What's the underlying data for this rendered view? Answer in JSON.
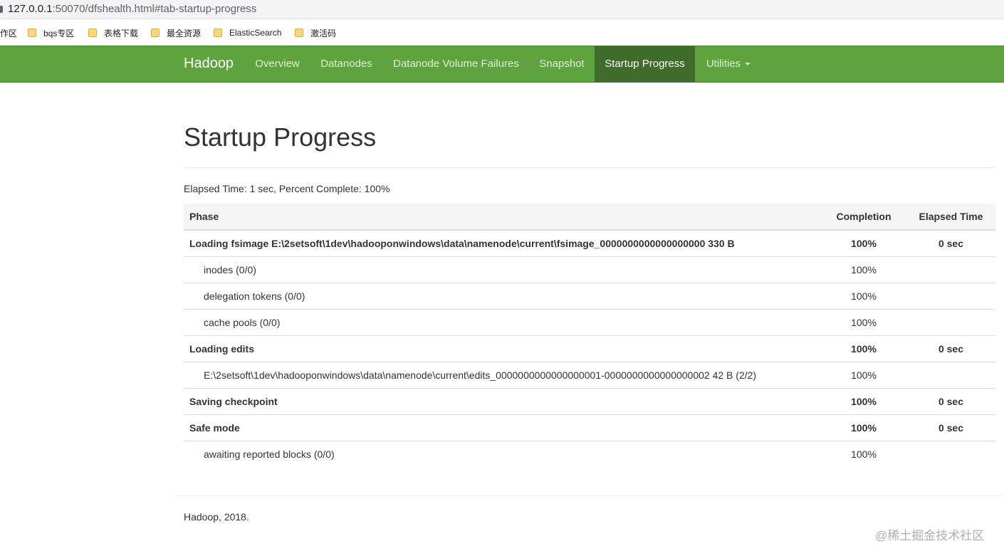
{
  "browser": {
    "url_host": "127.0.0.1",
    "url_rest": ":50070/dfshealth.html#tab-startup-progress"
  },
  "bookmarks": [
    {
      "label": "作区"
    },
    {
      "label": "bqs专区"
    },
    {
      "label": "表格下载"
    },
    {
      "label": "最全资源"
    },
    {
      "label": "ElasticSearch"
    },
    {
      "label": "激活码"
    }
  ],
  "navbar": {
    "brand": "Hadoop",
    "links": [
      {
        "label": "Overview"
      },
      {
        "label": "Datanodes"
      },
      {
        "label": "Datanode Volume Failures"
      },
      {
        "label": "Snapshot"
      },
      {
        "label": "Startup Progress"
      },
      {
        "label": "Utilities"
      }
    ]
  },
  "page": {
    "title": "Startup Progress",
    "summary": "Elapsed Time: 1 sec, Percent Complete: 100%"
  },
  "table": {
    "headers": {
      "phase": "Phase",
      "completion": "Completion",
      "elapsed": "Elapsed Time"
    },
    "rows": [
      {
        "phase": "Loading fsimage E:\\2setsoft\\1dev\\hadooponwindows\\data\\namenode\\current\\fsimage_0000000000000000000 330 B",
        "completion": "100%",
        "elapsed": "0 sec"
      },
      {
        "phase": "inodes (0/0)",
        "completion": "100%",
        "elapsed": ""
      },
      {
        "phase": "delegation tokens (0/0)",
        "completion": "100%",
        "elapsed": ""
      },
      {
        "phase": "cache pools (0/0)",
        "completion": "100%",
        "elapsed": ""
      },
      {
        "phase": "Loading edits",
        "completion": "100%",
        "elapsed": "0 sec"
      },
      {
        "phase": "E:\\2setsoft\\1dev\\hadooponwindows\\data\\namenode\\current\\edits_0000000000000000001-0000000000000000002 42 B (2/2)",
        "completion": "100%",
        "elapsed": ""
      },
      {
        "phase": "Saving checkpoint",
        "completion": "100%",
        "elapsed": "0 sec"
      },
      {
        "phase": "Safe mode",
        "completion": "100%",
        "elapsed": "0 sec"
      },
      {
        "phase": "awaiting reported blocks (0/0)",
        "completion": "100%",
        "elapsed": ""
      }
    ]
  },
  "footer": {
    "text": "Hadoop, 2018."
  },
  "watermark": {
    "text": "@稀土掘金技术社区"
  }
}
